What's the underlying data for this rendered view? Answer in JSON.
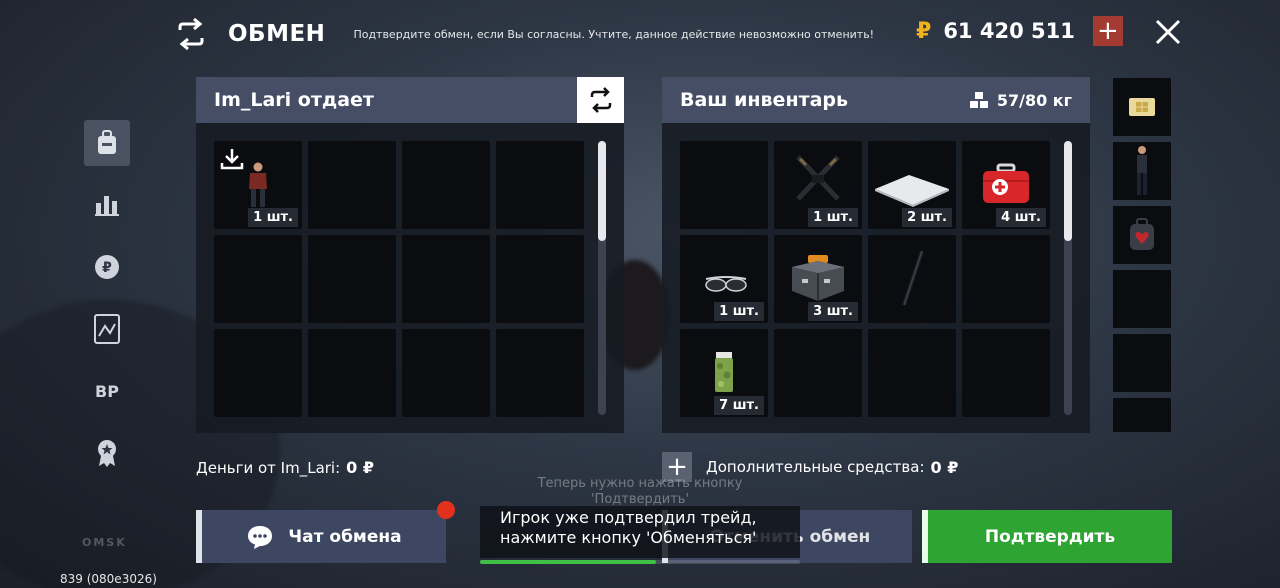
{
  "header": {
    "title": "ОБМЕН",
    "note": "Подтвердите обмен, если Вы согласны. Учтите, данное действие невозможно отменить!",
    "currency_symbol": "₽",
    "balance": "61 420 511",
    "add_label": "+"
  },
  "sidebar": {
    "items": [
      {
        "name": "backpack",
        "label": ""
      },
      {
        "name": "stats",
        "label": ""
      },
      {
        "name": "ruble",
        "label": ""
      },
      {
        "name": "tablet",
        "label": ""
      },
      {
        "name": "bp",
        "label": "BP"
      },
      {
        "name": "award",
        "label": ""
      }
    ]
  },
  "left_panel": {
    "title": "Im_Lari отдает",
    "cells": [
      {
        "item": "character-skin",
        "qty": "1 шт.",
        "icon": "download-icon"
      },
      {
        "item": "",
        "qty": ""
      },
      {
        "item": "",
        "qty": ""
      },
      {
        "item": "",
        "qty": ""
      },
      {
        "item": "",
        "qty": ""
      },
      {
        "item": "",
        "qty": ""
      },
      {
        "item": "",
        "qty": ""
      },
      {
        "item": "",
        "qty": ""
      },
      {
        "item": "",
        "qty": ""
      },
      {
        "item": "",
        "qty": ""
      },
      {
        "item": "",
        "qty": ""
      },
      {
        "item": "",
        "qty": ""
      }
    ]
  },
  "right_panel": {
    "title": "Ваш инвентарь",
    "weight": "57/80 кг",
    "cells": [
      {
        "item": "",
        "qty": ""
      },
      {
        "item": "crossed-weapons",
        "qty": "1 шт."
      },
      {
        "item": "paper-sheet",
        "qty": "2 шт."
      },
      {
        "item": "first-aid-kit",
        "qty": "4 шт."
      },
      {
        "item": "sunglasses",
        "qty": "1 шт."
      },
      {
        "item": "toolbox",
        "qty": "3 шт."
      },
      {
        "item": "baton",
        "qty": ""
      },
      {
        "item": "",
        "qty": ""
      },
      {
        "item": "herb-jar",
        "qty": "7 шт."
      },
      {
        "item": "",
        "qty": ""
      },
      {
        "item": "",
        "qty": ""
      },
      {
        "item": "",
        "qty": ""
      }
    ]
  },
  "strip": {
    "items": [
      "sim-card",
      "character-skin",
      "backpack-heart",
      "",
      "",
      ""
    ]
  },
  "money_from": {
    "label": "Деньги от Im_Lari:",
    "value": "0 ₽"
  },
  "extra_funds": {
    "label": "Дополнительные средства:",
    "value": "0 ₽"
  },
  "hint": {
    "line1": "Теперь нужно нажать кнопку",
    "line2": "'Подтвердить'"
  },
  "buttons": {
    "chat": "Чат обмена",
    "cancel": "Отменить обмен",
    "confirm": "Подтвердить"
  },
  "toast": {
    "line1": "Игрок уже подтвердил трейд,",
    "line2": "нажмите кнопку 'Обменяться'",
    "progress": 0.55
  },
  "footer": {
    "build": "839 (080e3026)",
    "logo": "OMSK"
  },
  "colors": {
    "accent_money": "#f2b21f",
    "confirm": "#2ea533",
    "danger": "#a33b33",
    "header": "#464e66"
  }
}
